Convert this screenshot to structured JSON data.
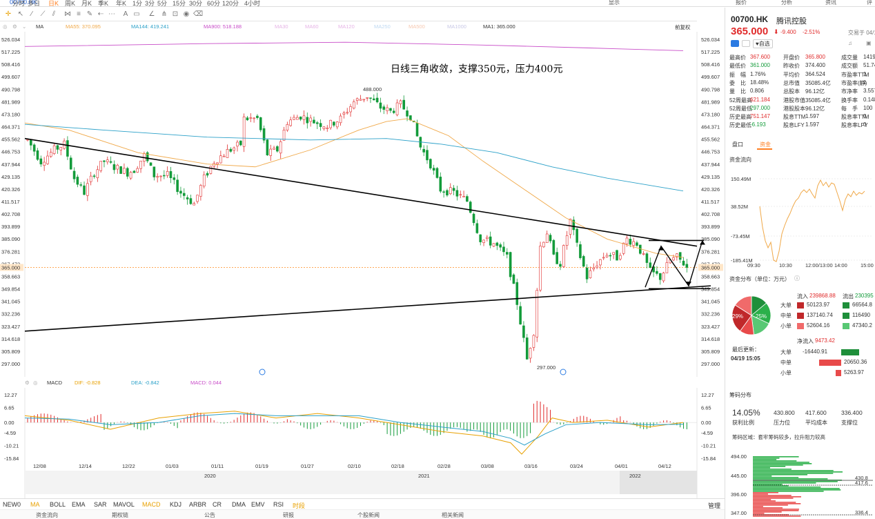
{
  "topbar": {
    "symbol": "00700.HK",
    "periods": [
      "分时",
      "多日",
      "日K",
      "周K",
      "月K",
      "季K",
      "年K",
      "1分",
      "3分",
      "5分",
      "15分",
      "30分",
      "60分",
      "120分",
      "4小时"
    ],
    "active_period": "日K",
    "right_menu": [
      "显示",
      "▢",
      "▢"
    ],
    "panel_tabs": [
      "报价",
      "分析",
      "资讯",
      "评"
    ]
  },
  "ma_legend": [
    {
      "label": "MA",
      "color": "#333333"
    },
    {
      "label": "MA55: 370.095",
      "color": "#f0a848"
    },
    {
      "label": "MA144: 419.241",
      "color": "#2aa0c8"
    },
    {
      "label": "MA900: 518.188",
      "color": "#c84cc8"
    },
    {
      "label": "MA30",
      "color": "#e6b4e6"
    },
    {
      "label": "MA60",
      "color": "#e6b4e6"
    },
    {
      "label": "MA120",
      "color": "#e6b4e6"
    },
    {
      "label": "MA250",
      "color": "#bfd9f2"
    },
    {
      "label": "MA500",
      "color": "#f6c8b0"
    },
    {
      "label": "MA1000",
      "color": "#c8c8e6"
    },
    {
      "label": "MA1: 365.000",
      "color": "#333333"
    }
  ],
  "ma2_label": "MA",
  "fq_label": "前复权",
  "price_axis": [
    "526.034",
    "517.225",
    "508.416",
    "499.607",
    "490.798",
    "481.989",
    "473.180",
    "464.371",
    "455.562",
    "446.753",
    "437.944",
    "429.135",
    "420.326",
    "411.517",
    "402.708",
    "393.899",
    "385.090",
    "376.281",
    "367.472",
    "358.663",
    "349.854",
    "341.045",
    "332.236",
    "323.427",
    "314.618",
    "305.809",
    "297.000"
  ],
  "current_price_tag": "365.000",
  "annotation": "日线三角收敛，支撑350元，压力400元",
  "high_label": "488.000",
  "low_label": "297.000",
  "macd_legend": {
    "name": "MACD",
    "dif": "DIF: -0.828",
    "dea": "DEA: -0.842",
    "macd": "MACD: 0.044"
  },
  "macd_axis": [
    "12.27",
    "6.65",
    "0.00",
    "-4.59",
    "-10.21",
    "-15.84"
  ],
  "x_axis": [
    "12/08",
    "12/14",
    "12/22",
    "01/03",
    "01/11",
    "01/19",
    "01/27",
    "02/10",
    "02/18",
    "02/28",
    "03/08",
    "03/16",
    "03/24",
    "04/01",
    "04/12"
  ],
  "years": [
    "2020",
    "2021",
    "2022"
  ],
  "bottom_tabs": [
    "NEW0",
    "MA",
    "BOLL",
    "EMA",
    "SAR",
    "MAVOL",
    "MACD",
    "KDJ",
    "ARBR",
    "CR",
    "DMA",
    "EMV",
    "RSI",
    "时段"
  ],
  "active_bottom": [
    "MA",
    "MACD"
  ],
  "manage_label": "管理",
  "footer_tabs": [
    "资金流向",
    "期权链",
    "公告",
    "研报",
    "个股新闻",
    "相关新闻"
  ],
  "quote": {
    "code": "00700.HK",
    "name": "腾讯控股",
    "price": "365.000",
    "change": "-9.400",
    "pct": "-2.51%",
    "trade_date": "交易于 04/1",
    "tag1": "自选",
    "rows": [
      [
        "最高价",
        "367.600",
        "开盘价",
        "365.800",
        "成交量",
        "1419"
      ],
      [
        "最低价",
        "361.000",
        "昨收价",
        "374.400",
        "成交额",
        "51.74"
      ],
      [
        "振　幅",
        "1.76%",
        "平均价",
        "364.524",
        "市盈率TTM",
        "1"
      ],
      [
        "委　比",
        "18.48%",
        "总市值",
        "35085.4亿",
        "市盈率(静)",
        "1"
      ],
      [
        "量　比",
        "0.806",
        "总股本",
        "96.12亿",
        "市净率",
        "3.557"
      ],
      [
        "52周最高",
        "621.184",
        "港股市值",
        "35085.4亿",
        "换手率",
        "0.148"
      ],
      [
        "52周最低",
        "297.000",
        "港股股本",
        "96.12亿",
        "每　手",
        "100"
      ],
      [
        "历史最高",
        "751.147",
        "股息TTM",
        "1.597",
        "股息率TTM",
        "0"
      ],
      [
        "历史最低",
        "-6.193",
        "股息LFY",
        "1.597",
        "股息率LFY",
        "0"
      ]
    ],
    "sub_tabs": [
      "盘口",
      "资金"
    ],
    "flow_title": "资金流向",
    "flow_axis": [
      "150.49M",
      "38.52M",
      "-73.45M",
      "-185.41M"
    ],
    "flow_times": [
      "09:30",
      "10:30",
      "12:00/13:00",
      "14:00",
      "15:00"
    ],
    "dist_title": "资金分布（单位：万元）",
    "in_label": "流入",
    "in_total": "239868.88",
    "out_label": "流出",
    "out_total": "230395",
    "dist_rows": [
      {
        "label": "大单",
        "in": "50123.97",
        "out": "66564.8"
      },
      {
        "label": "中单",
        "in": "137140.74",
        "out": "116490"
      },
      {
        "label": "小单",
        "in": "52604.16",
        "out": "47340.2"
      }
    ],
    "pie_red": "29%",
    "pie_green": "25%",
    "net_label": "净流入",
    "net_value": "9473.42",
    "update_label": "最后更新：",
    "update_time": "04/19 15:05",
    "net_rows": [
      {
        "label": "大单",
        "value": "-16440.91"
      },
      {
        "label": "中单",
        "value": "20650.36"
      },
      {
        "label": "小单",
        "value": "5263.97"
      }
    ],
    "chips_title": "筹码分布",
    "chip_vals": [
      "14.05%",
      "430.800",
      "417.600",
      "336.400"
    ],
    "chip_labels": [
      "获利比例",
      "压力位",
      "平均成本",
      "支撑位"
    ],
    "chip_note": "筹码区域：套牢筹码较多，拉升阻力较高",
    "chip_axis": [
      "494.00",
      "445.00",
      "396.00",
      "347.00"
    ],
    "chip_markers": [
      "430.8",
      "417.6",
      "336.4"
    ]
  }
}
